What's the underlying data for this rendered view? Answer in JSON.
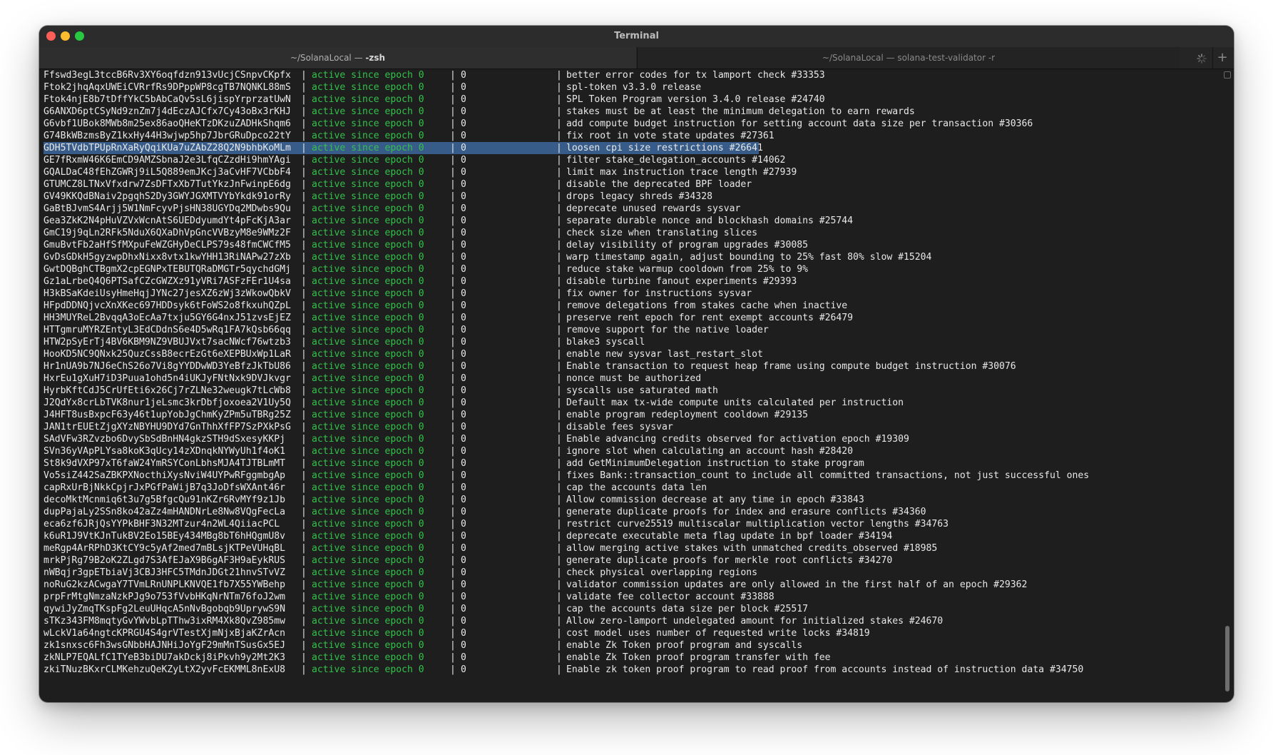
{
  "window": {
    "title": "Terminal"
  },
  "tabs": [
    {
      "prefix": "~/SolanaLocal — ",
      "command": "-zsh"
    },
    {
      "label": "~/SolanaLocal — solana-test-validator -r"
    }
  ],
  "icons": {
    "spinner": "loading-spinner-icon",
    "new_tab": "plus-icon"
  },
  "colors": {
    "status_green": "#33c24a",
    "selection": "#375c8a",
    "background": "#1e1e1e"
  },
  "separator": "|",
  "selected_row_index": 6,
  "rows": [
    {
      "id": "Ffswd3egL3tccB6Rv3XY6oqfdzn913vUcjCSnpvCKpfx",
      "status": "active since epoch 0",
      "activation": "0",
      "description": "better error codes for tx lamport check #33353"
    },
    {
      "id": "Ftok2jhqAqxUWEiCVRrfRs9DPppWP8cgTB7NQNKL88mS",
      "status": "active since epoch 0",
      "activation": "0",
      "description": "spl-token v3.3.0 release"
    },
    {
      "id": "Ftok4njE8b7tDffYkC5bAbCaQv5sL6jispYrprzatUwN",
      "status": "active since epoch 0",
      "activation": "0",
      "description": "SPL Token Program version 3.4.0 release #24740"
    },
    {
      "id": "G6ANXD6ptCSyNd9znZm7j4dEczAJCfx7Cy43oBx3rKHJ",
      "status": "active since epoch 0",
      "activation": "0",
      "description": "stakes must be at least the minimum delegation to earn rewards"
    },
    {
      "id": "G6vbf1UBok8MWb8m25ex86aoQHeKTzDKzuZADHkShqm6",
      "status": "active since epoch 0",
      "activation": "0",
      "description": "add compute budget instruction for setting account data size per transaction #30366"
    },
    {
      "id": "G74BkWBzmsByZ1kxHy44H3wjwp5hp7JbrGRuDpco22tY",
      "status": "active since epoch 0",
      "activation": "0",
      "description": "fix root in vote state updates #27361"
    },
    {
      "id": "GDH5TVdbTPUpRnXaRyQqiKUa7uZAbZ28Q2N9bhbKoMLm",
      "status": "active since epoch 0",
      "activation": "0",
      "description": "loosen cpi size restrictions #26641"
    },
    {
      "id": "GE7fRxmW46K6EmCD9AMZSbnaJ2e3LfqCZzdHi9hmYAgi",
      "status": "active since epoch 0",
      "activation": "0",
      "description": "filter stake_delegation_accounts #14062"
    },
    {
      "id": "GQALDaC48fEhZGWRj9iL5Q889emJKcj3aCvHF7VCbbF4",
      "status": "active since epoch 0",
      "activation": "0",
      "description": "limit max instruction trace length #27939"
    },
    {
      "id": "GTUMCZ8LTNxVfxdrw7ZsDFTxXb7TutYkzJnFwinpE6dg",
      "status": "active since epoch 0",
      "activation": "0",
      "description": "disable the deprecated BPF loader"
    },
    {
      "id": "GV49KKQdBNaiv2pgqhS2Dy3GWYJGXMTVYbYkdk91orRy",
      "status": "active since epoch 0",
      "activation": "0",
      "description": "drops legacy shreds #34328"
    },
    {
      "id": "GaBtBJvmS4Arjj5W1NmFcyvPjsHN38UGYDq2MDwbs9Qu",
      "status": "active since epoch 0",
      "activation": "0",
      "description": "deprecate unused rewards sysvar"
    },
    {
      "id": "Gea3ZkK2N4pHuVZVxWcnAtS6UEDdyumdYt4pFcKjA3ar",
      "status": "active since epoch 0",
      "activation": "0",
      "description": "separate durable nonce and blockhash domains #25744"
    },
    {
      "id": "GmC19j9qLn2RFk5NduX6QXaDhVpGncVVBzyM8e9WMz2F",
      "status": "active since epoch 0",
      "activation": "0",
      "description": "check size when translating slices"
    },
    {
      "id": "GmuBvtFb2aHfSfMXpuFeWZGHyDeCLPS79s48fmCWCfM5",
      "status": "active since epoch 0",
      "activation": "0",
      "description": "delay visibility of program upgrades #30085"
    },
    {
      "id": "GvDsGDkH5gyzwpDhxNixx8vtx1kwYHH13RiNAPw27zXb",
      "status": "active since epoch 0",
      "activation": "0",
      "description": "warp timestamp again, adjust bounding to 25% fast 80% slow #15204"
    },
    {
      "id": "GwtDQBghCTBgmX2cpEGNPxTEBUTQRaDMGTr5qychdGMj",
      "status": "active since epoch 0",
      "activation": "0",
      "description": "reduce stake warmup cooldown from 25% to 9%"
    },
    {
      "id": "Gz1aLrbeQ4Q6PTSafCZcGWZXz91yVRi7ASFzFEr1U4sa",
      "status": "active since epoch 0",
      "activation": "0",
      "description": "disable turbine fanout experiments #29393"
    },
    {
      "id": "H3kBSaKdeiUsyHmeHqjJYNc27jesXZ6zWj3zWkowQbkV",
      "status": "active since epoch 0",
      "activation": "0",
      "description": "fix owner for instructions sysvar"
    },
    {
      "id": "HFpdDDNQjvcXnXKec697HDDsyk6tFoWS2o8fkxuhQZpL",
      "status": "active since epoch 0",
      "activation": "0",
      "description": "remove delegations from stakes cache when inactive"
    },
    {
      "id": "HH3MUYReL2BvqqA3oEcAa7txju5GY6G4nxJ51zvsEjEZ",
      "status": "active since epoch 0",
      "activation": "0",
      "description": "preserve rent epoch for rent exempt accounts #26479"
    },
    {
      "id": "HTTgmruMYRZEntyL3EdCDdnS6e4D5wRq1FA7kQsb66qq",
      "status": "active since epoch 0",
      "activation": "0",
      "description": "remove support for the native loader"
    },
    {
      "id": "HTW2pSyErTj4BV6KBM9NZ9VBUJVxt7sacNWcf76wtzb3",
      "status": "active since epoch 0",
      "activation": "0",
      "description": "blake3 syscall"
    },
    {
      "id": "HooKD5NC9QNxk25QuzCssB8ecrEzGt6eXEPBUxWp1LaR",
      "status": "active since epoch 0",
      "activation": "0",
      "description": "enable new sysvar last_restart_slot"
    },
    {
      "id": "Hr1nUA9b7NJ6eChS26o7Vi8gYYDDwWD3YeBfzJkTbU86",
      "status": "active since epoch 0",
      "activation": "0",
      "description": "Enable transaction to request heap frame using compute budget instruction #30076"
    },
    {
      "id": "HxrEu1gXuH7iD3Puua1ohd5n4iUKJyFNtNxk9DVJkvgr",
      "status": "active since epoch 0",
      "activation": "0",
      "description": "nonce must be authorized"
    },
    {
      "id": "HyrbKftCdJ5CrUfEti6x26Cj7rZLNe32weugk7tLcWb8",
      "status": "active since epoch 0",
      "activation": "0",
      "description": "syscalls use saturated math"
    },
    {
      "id": "J2QdYx8crLbTVK8nur1jeLsmc3krDbfjoxoea2V1Uy5Q",
      "status": "active since epoch 0",
      "activation": "0",
      "description": "Default max tx-wide compute units calculated per instruction"
    },
    {
      "id": "J4HFT8usBxpcF63y46t1upYobJgChmKyZPm5uTBRg25Z",
      "status": "active since epoch 0",
      "activation": "0",
      "description": "enable program redeployment cooldown #29135"
    },
    {
      "id": "JAN1trEUEtZjgXYzNBYHU9DYd7GnThhXfFP7SzPXkPsG",
      "status": "active since epoch 0",
      "activation": "0",
      "description": "disable fees sysvar"
    },
    {
      "id": "SAdVFw3RZvzbo6DvySbSdBnHN4gkzSTH9dSxesyKKPj",
      "status": "active since epoch 0",
      "activation": "0",
      "description": "Enable advancing credits observed for activation epoch #19309"
    },
    {
      "id": "SVn36yVApPLYsa8koK3qUcy14zXDnqkNYWyUh1f4oK1",
      "status": "active since epoch 0",
      "activation": "0",
      "description": "ignore slot when calculating an account hash #28420"
    },
    {
      "id": "St8k9dVXP97xT6faW24YmRSYConLbhsMJA4TJTBLmMT",
      "status": "active since epoch 0",
      "activation": "0",
      "description": "add GetMinimumDelegation instruction to stake program"
    },
    {
      "id": "Vo5siZ442SaZBKPXNocthiXysNviW4UYPwRFggmbgAp",
      "status": "active since epoch 0",
      "activation": "0",
      "description": "fixes Bank::transaction_count to include all committed transactions, not just successful ones"
    },
    {
      "id": "capRxUrBjNkkCpjrJxPGfPaWijB7q3JoDfsWXAnt46r",
      "status": "active since epoch 0",
      "activation": "0",
      "description": "cap the accounts data len"
    },
    {
      "id": "decoMktMcnmiq6t3u7g5BfgcQu91nKZr6RvMYf9z1Jb",
      "status": "active since epoch 0",
      "activation": "0",
      "description": "Allow commission decrease at any time in epoch #33843"
    },
    {
      "id": "dupPajaLy2SSn8ko42aZz4mHANDNrLe8Nw8VQgFecLa",
      "status": "active since epoch 0",
      "activation": "0",
      "description": "generate duplicate proofs for index and erasure conflicts #34360"
    },
    {
      "id": "eca6zf6JRjQsYYPkBHF3N32MTzur4n2WL4QiiacPCL",
      "status": "active since epoch 0",
      "activation": "0",
      "description": "restrict curve25519 multiscalar multiplication vector lengths #34763"
    },
    {
      "id": "k6uR1J9VtKJnTukBV2Eo15BEy434MBg8bT6hHQgmU8v",
      "status": "active since epoch 0",
      "activation": "0",
      "description": "deprecate executable meta flag update in bpf loader #34194"
    },
    {
      "id": "meRgp4ArRPhD3KtCY9c5yAf2med7mBLsjKTPeVUHqBL",
      "status": "active since epoch 0",
      "activation": "0",
      "description": "allow merging active stakes with unmatched credits_observed #18985"
    },
    {
      "id": "mrkPjRg79B2oK2ZLgd7S3AfEJaX9B6gAF3H9aEykRUS",
      "status": "active since epoch 0",
      "activation": "0",
      "description": "generate duplicate proofs for merkle root conflicts #34270"
    },
    {
      "id": "nWBqjr3gpETbiaVj3CBJ3HFC5TMdnJDGt21hnvSTvVZ",
      "status": "active since epoch 0",
      "activation": "0",
      "description": "check physical overlapping regions"
    },
    {
      "id": "noRuG2kzACwgaY7TVmLRnUNPLKNVQE1fb7X55YWBehp",
      "status": "active since epoch 0",
      "activation": "0",
      "description": "validator commission updates are only allowed in the first half of an epoch #29362"
    },
    {
      "id": "prpFrMtgNmzaNzkPJg9o753fVvbHKqNrNTm76foJ2wm",
      "status": "active since epoch 0",
      "activation": "0",
      "description": "validate fee collector account #33888"
    },
    {
      "id": "qywiJyZmqTKspFg2LeuUHqcA5nNvBgobqb9UprywS9N",
      "status": "active since epoch 0",
      "activation": "0",
      "description": "cap the accounts data size per block #25517"
    },
    {
      "id": "sTKz343FM8mqtyGvYWvbLpTThw3ixRM4Xk8QvZ985mw",
      "status": "active since epoch 0",
      "activation": "0",
      "description": "Allow zero-lamport undelegated amount for initialized stakes #24670"
    },
    {
      "id": "wLckV1a64ngtcKPRGU4S4grVTestXjmNjxBjaKZrAcn",
      "status": "active since epoch 0",
      "activation": "0",
      "description": "cost model uses number of requested write locks #34819"
    },
    {
      "id": "zk1snxsc6Fh3wsGNbbHAJNHiJoYgF29mMnTSusGx5EJ",
      "status": "active since epoch 0",
      "activation": "0",
      "description": "enable Zk Token proof program and syscalls"
    },
    {
      "id": "zkNLP7EQALfC1TYeB3biDU7akDckj8iPkvh9y2Mt2K3",
      "status": "active since epoch 0",
      "activation": "0",
      "description": "enable Zk Token proof program transfer with fee"
    },
    {
      "id": "zkiTNuzBKxrCLMKehzuQeKZyLtX2yvFcEKMML8nExU8",
      "status": "active since epoch 0",
      "activation": "0",
      "description": "Enable zk token proof program to read proof from accounts instead of instruction data #34750"
    }
  ]
}
